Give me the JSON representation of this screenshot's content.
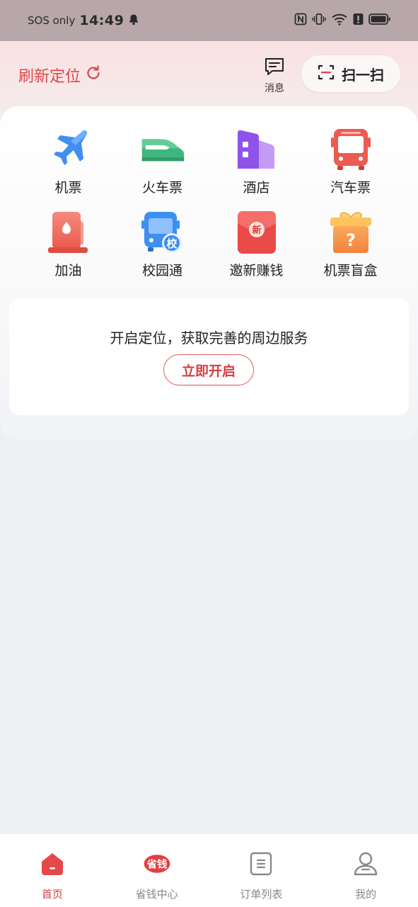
{
  "status_bar": {
    "carrier": "SOS only",
    "time": "14:49"
  },
  "header": {
    "refresh_label": "刷新定位",
    "message_label": "消息",
    "scan_label": "扫一扫"
  },
  "services": [
    {
      "label": "机票",
      "icon": "airplane-icon"
    },
    {
      "label": "火车票",
      "icon": "train-icon"
    },
    {
      "label": "酒店",
      "icon": "hotel-icon"
    },
    {
      "label": "汽车票",
      "icon": "bus-icon"
    },
    {
      "label": "加油",
      "icon": "fuel-icon"
    },
    {
      "label": "校园通",
      "icon": "school-bus-icon",
      "badge": "校"
    },
    {
      "label": "邀新赚钱",
      "icon": "red-envelope-icon",
      "badge": "新"
    },
    {
      "label": "机票盲盒",
      "icon": "mystery-box-icon",
      "badge": "?"
    }
  ],
  "location": {
    "text": "开启定位，获取完善的周边服务",
    "button": "立即开启"
  },
  "tabbar": {
    "tabs": [
      {
        "label": "首页",
        "icon": "home-icon",
        "active": true
      },
      {
        "label": "省钱中心",
        "icon": "save-money-icon",
        "badge": "省钱"
      },
      {
        "label": "订单列表",
        "icon": "order-list-icon"
      },
      {
        "label": "我的",
        "icon": "profile-icon"
      }
    ]
  },
  "colors": {
    "accent": "#e0454a",
    "status_bar": "#b8a7aa"
  }
}
